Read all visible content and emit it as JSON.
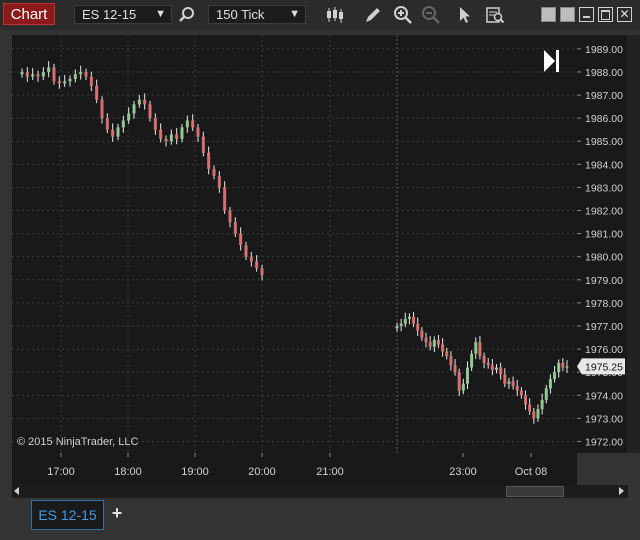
{
  "toolbar": {
    "chart_button": "Chart",
    "instrument": "ES 12-15",
    "interval": "150 Tick",
    "icons": [
      "search-icon",
      "bar-type-icon",
      "pencil-draw-icon",
      "zoom-in-icon",
      "zoom-out-icon",
      "pointer-icon",
      "data-box-icon"
    ],
    "window_controls": [
      "tile-icon",
      "tile-icon",
      "minimize-icon",
      "maximize-icon",
      "close-icon"
    ]
  },
  "chart": {
    "copyright": "© 2015 NinjaTrader, LLC",
    "current_price": "1975.25",
    "colors": {
      "up": "#90c890",
      "down": "#d87070",
      "background": "#191919",
      "grid": "#3a3a3a"
    }
  },
  "chart_data": {
    "type": "candlestick",
    "instrument": "ES 12-15",
    "interval": "150 Tick",
    "ylim": [
      1971.5,
      1989.6
    ],
    "y_ticks": [
      1989.0,
      1988.0,
      1987.0,
      1986.0,
      1985.0,
      1984.0,
      1983.0,
      1982.0,
      1981.0,
      1980.0,
      1979.0,
      1978.0,
      1977.0,
      1976.0,
      1975.0,
      1974.0,
      1973.0,
      1972.0
    ],
    "x_ticks": [
      "17:00",
      "18:00",
      "19:00",
      "20:00",
      "21:00",
      "23:00",
      "Oct 08"
    ],
    "last_price": 1975.25,
    "segments": [
      {
        "session": "evening",
        "close_path": [
          1988.0,
          1987.8,
          1987.9,
          1987.8,
          1988.0,
          1988.2,
          1987.6,
          1987.5,
          1987.6,
          1987.7,
          1987.9,
          1988.0,
          1987.8,
          1987.4,
          1986.8,
          1986.0,
          1985.5,
          1985.2,
          1985.6,
          1985.9,
          1986.2,
          1986.6,
          1986.8,
          1986.6,
          1986.0,
          1985.5,
          1985.1,
          1985.0,
          1985.3,
          1985.1,
          1985.6,
          1985.9,
          1985.6,
          1985.2,
          1984.5,
          1983.8,
          1983.5,
          1983.0,
          1982.0,
          1981.5,
          1981.0,
          1980.5,
          1980.0,
          1979.8,
          1979.5,
          1979.2
        ]
      },
      {
        "session": "overnight",
        "close_path": [
          1977.0,
          1977.1,
          1977.3,
          1977.4,
          1977.1,
          1976.8,
          1976.5,
          1976.3,
          1976.1,
          1976.4,
          1976.2,
          1975.9,
          1975.7,
          1975.3,
          1975.0,
          1974.2,
          1974.5,
          1975.2,
          1975.8,
          1976.3,
          1975.7,
          1975.4,
          1975.3,
          1975.1,
          1975.2,
          1974.9,
          1974.5,
          1974.6,
          1974.4,
          1974.2,
          1974.0,
          1973.6,
          1973.3,
          1973.0,
          1973.4,
          1973.8,
          1974.3,
          1974.7,
          1975.0,
          1975.4,
          1975.2,
          1975.25
        ]
      }
    ]
  }
}
